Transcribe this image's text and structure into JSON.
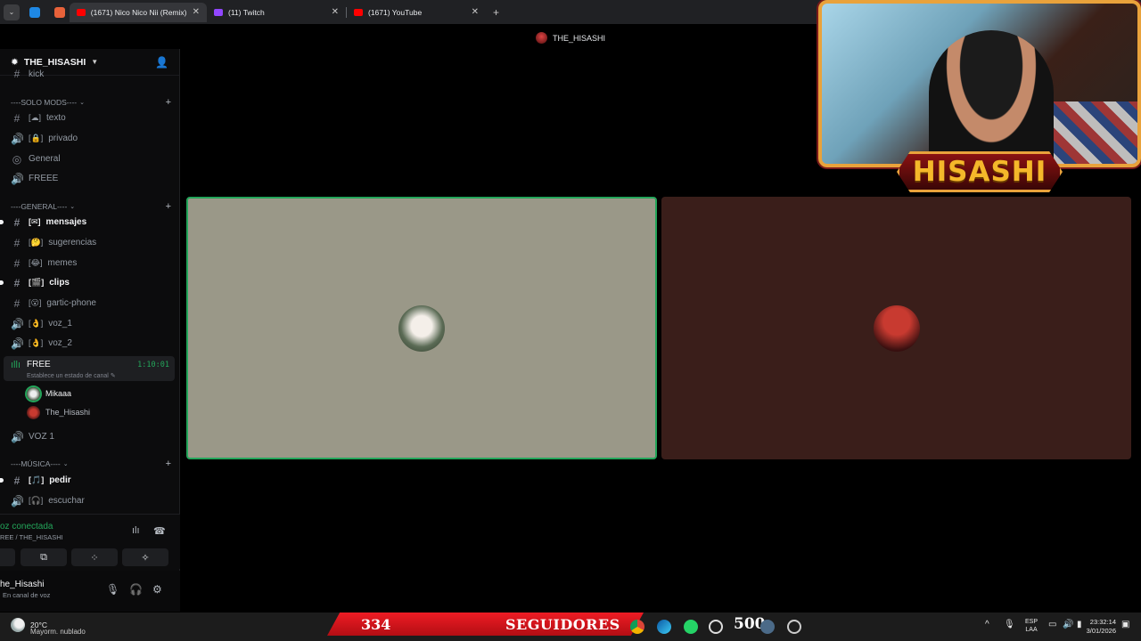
{
  "browser": {
    "tabs": [
      {
        "title": "(1671) Nico Nico Nii (Remix) - \\",
        "active": true
      },
      {
        "title": "(11) Twitch",
        "active": false
      },
      {
        "title": "(1671) YouTube",
        "active": false
      }
    ],
    "close_glyph": "✕",
    "new_tab_glyph": "+"
  },
  "titlebar": {
    "title": "THE_HISASHI"
  },
  "server": {
    "name": "THE_HISASHI"
  },
  "categories": {
    "solo_mods": "----SOLO MODS----",
    "general": "----GENERAL----",
    "musica": "----MÚSICA----"
  },
  "channels": {
    "truncated": "kick",
    "texto": "texto",
    "privado": "privado",
    "general": "General",
    "freee": "FREEE",
    "mensajes": "mensajes",
    "sugerencias": "sugerencias",
    "memes": "memes",
    "clips": "clips",
    "gartic": "gartic-phone",
    "voz1": "voz_1",
    "voz2": "voz_2",
    "voz_1_upper": "VOZ 1",
    "pedir": "pedir",
    "escuchar": "escuchar"
  },
  "active_voice": {
    "name": "FREE",
    "time": "1:10:01",
    "status": "Establece un estado de canal"
  },
  "voice_users": [
    "Mikaaa",
    "The_Hisashi"
  ],
  "voice_panel": {
    "title": "oz conectada",
    "subtitle": "REE / THE_HISASHI"
  },
  "user": {
    "name": "he_Hisashi",
    "status": "En canal de voz"
  },
  "overlay": {
    "cam_name": "HISASHI",
    "followers": "334",
    "followers_label": "SEGUIDORES",
    "goal": "500"
  },
  "taskbar": {
    "temp": "20°C",
    "weather": "Mayorm. nublado",
    "lang_line1": "ESP",
    "lang_line2": "LAA",
    "time": "23:32:14",
    "date": "3/01/2026"
  },
  "colors": {
    "accent_green": "#23a55a",
    "overlay_gold": "#e9a23b",
    "overlay_red": "#ee1c24"
  }
}
